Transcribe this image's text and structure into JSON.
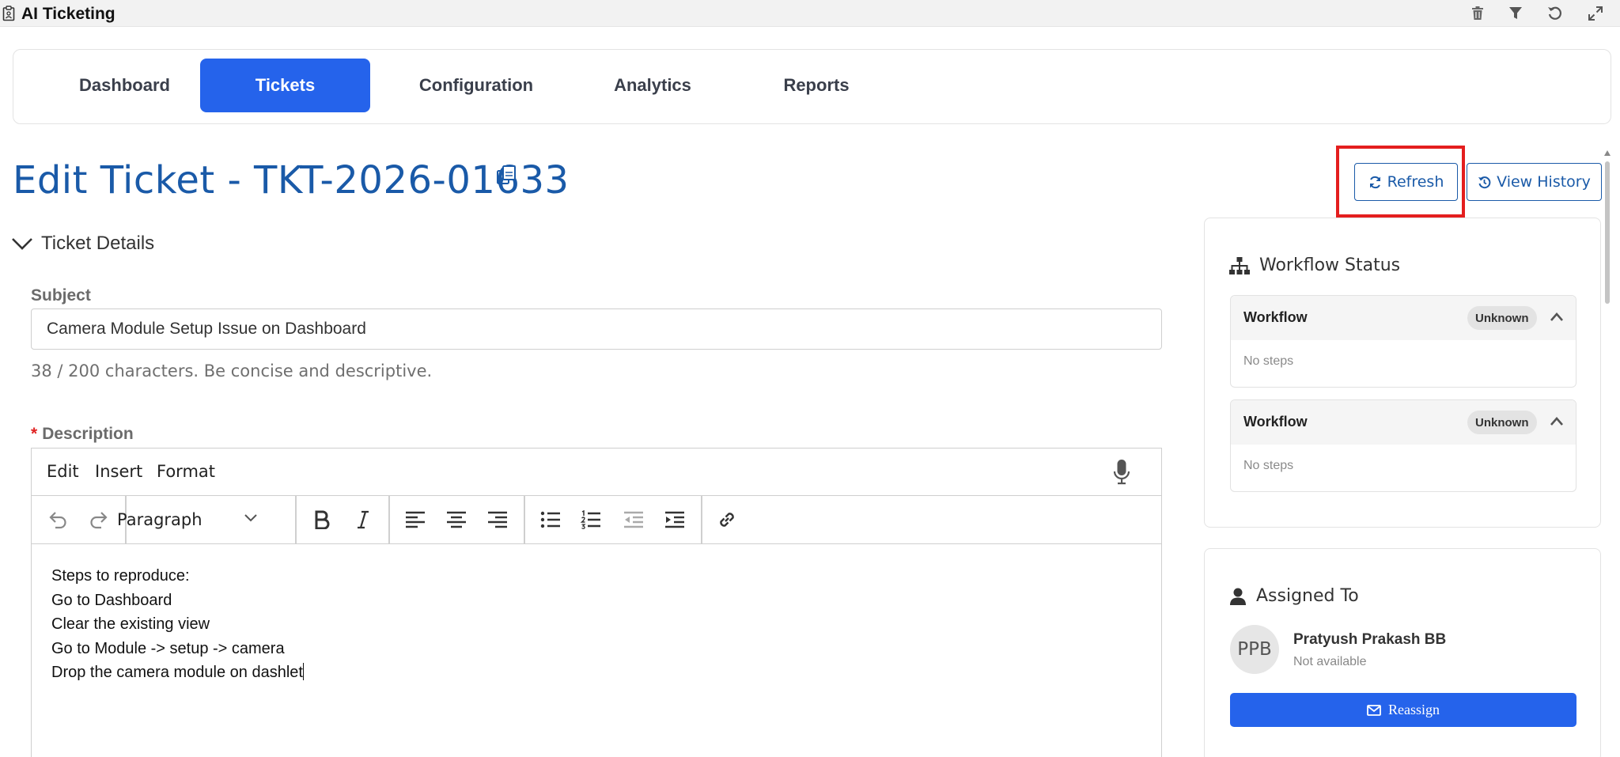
{
  "app": {
    "title": "AI Ticketing"
  },
  "toolbar": {
    "icons": [
      "trash-icon",
      "filter-icon",
      "refresh-icon",
      "expand-icon"
    ]
  },
  "nav": {
    "tabs": [
      {
        "label": "Dashboard",
        "active": false
      },
      {
        "label": "Tickets",
        "active": true
      },
      {
        "label": "Configuration",
        "active": false
      },
      {
        "label": "Analytics",
        "active": false
      },
      {
        "label": "Reports",
        "active": false
      }
    ]
  },
  "page": {
    "title": "Edit Ticket - TKT-2026-01633",
    "refresh_label": "Refresh",
    "history_label": "View History"
  },
  "ticket_details": {
    "section_label": "Ticket Details",
    "subject_label": "Subject",
    "subject_value": "Camera Module Setup Issue on Dashboard",
    "subject_helper": "38 / 200 characters. Be concise and descriptive.",
    "description_required": "*",
    "description_label": "Description"
  },
  "editor": {
    "menu": [
      "Edit",
      "Insert",
      "Format"
    ],
    "block_format": "Paragraph",
    "content_lines": [
      "Steps to reproduce:",
      "Go to Dashboard",
      "Clear the existing view",
      "Go to Module -> setup -> camera",
      "Drop the camera module on dashlet"
    ]
  },
  "workflow_status": {
    "heading": "Workflow Status",
    "workflows": [
      {
        "title": "Workflow",
        "badge": "Unknown",
        "body": "No steps"
      },
      {
        "title": "Workflow",
        "badge": "Unknown",
        "body": "No steps"
      }
    ]
  },
  "assigned_to": {
    "heading": "Assigned To",
    "initials": "PPB",
    "name": "Pratyush Prakash BB",
    "status": "Not available",
    "reassign_label": "Reassign"
  },
  "colors": {
    "primary": "#2563eb",
    "title_blue": "#1a5aa8",
    "highlight_red": "#e41e1e"
  }
}
